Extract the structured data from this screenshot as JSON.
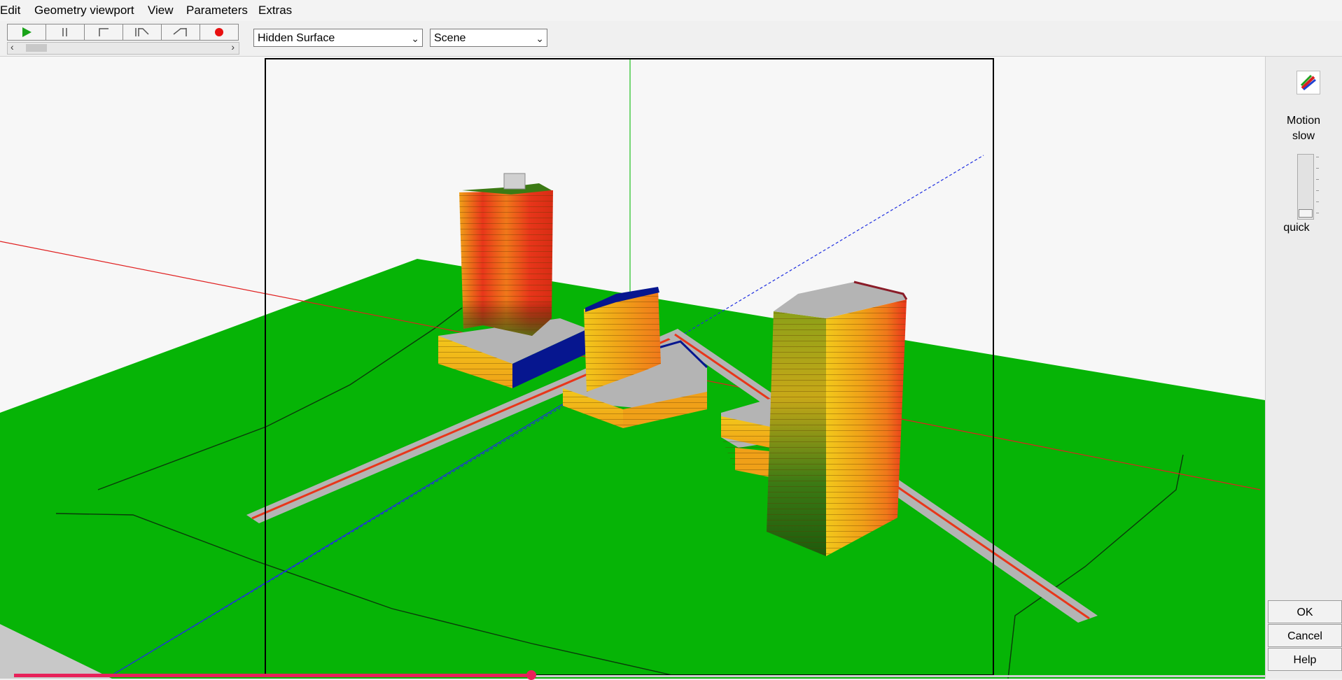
{
  "menu": {
    "items": [
      "Edit",
      "Geometry viewport",
      "View",
      "Parameters",
      "Extras"
    ]
  },
  "toolbar": {
    "buttons": [
      "play-icon",
      "pause-icon",
      "step-start-icon",
      "step-forward-icon",
      "step-end-icon",
      "record-icon"
    ],
    "render_mode": "Hidden Surface",
    "scene": "Scene"
  },
  "side_panel": {
    "motion_label": "Motion",
    "slow_label": "slow",
    "quick_label": "quick"
  },
  "actions": {
    "ok": "OK",
    "cancel": "Cancel",
    "help": "Help"
  },
  "colors": {
    "ground": "#06b406",
    "surface": "#b4b4b4",
    "heat_red": "#e8361a",
    "heat_orange": "#f58a12",
    "heat_yellow": "#f2c81a",
    "heat_green": "#3c7a14",
    "accent_blue": "#06168f",
    "axis_red": "#e02020",
    "axis_green": "#20c020",
    "axis_blue": "#2030e0",
    "record_red": "#e81010"
  },
  "video_progress": 0.39
}
